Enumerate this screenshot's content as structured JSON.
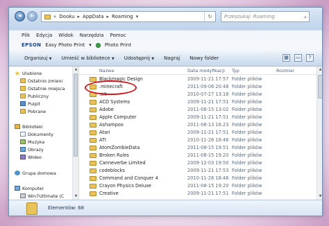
{
  "address": {
    "crumbs": [
      "Dooku",
      "AppData",
      "Roaming"
    ],
    "search_placeholder": "Przeszukaj: Roaming"
  },
  "menu": [
    "Plik",
    "Edycja",
    "Widok",
    "Narzędzia",
    "Pomoc"
  ],
  "epson": {
    "logo": "EPSON",
    "app1": "Easy Photo Print",
    "app2": "Photo Print"
  },
  "commands": {
    "organize": "Organizuj",
    "include": "Umieść w bibliotece",
    "share": "Udostępnij",
    "burn": "Nagraj",
    "new_folder": "Nowy folder"
  },
  "nav": {
    "favorites": "Ulubione",
    "recent": "Ostatnio zmieni",
    "recent_places": "Ostatnie miejsca",
    "public": "Publiczny",
    "desktop": "Pulpit",
    "downloads": "Pobrane",
    "libraries": "Biblioteki",
    "documents": "Dokumenty",
    "music": "Muzyka",
    "pictures": "Obrazy",
    "videos": "Wideo",
    "homegroup": "Grupa domowa",
    "computer": "Komputer",
    "drive": "Win7Ultimate (C"
  },
  "columns": {
    "name": "Nazwa",
    "date": "Data modyfikacji",
    "type": "Typ",
    "size": "Rozmiar"
  },
  "files": [
    {
      "name": "Blackmagic Design",
      "date": "2009-11-21 17:57",
      "type": "Folder plików"
    },
    {
      "name": ".minecraft",
      "date": "2011-09-06 20:48",
      "type": "Folder plików"
    },
    {
      "name": ".oit",
      "date": "2010-07-27 13:18",
      "type": "Folder plików"
    },
    {
      "name": "ACD Systems",
      "date": "2009-11-21 17:51",
      "type": "Folder plików"
    },
    {
      "name": "Adobe",
      "date": "2011-08-15 13:02",
      "type": "Folder plików"
    },
    {
      "name": "Apple Computer",
      "date": "2009-11-21 17:51",
      "type": "Folder plików"
    },
    {
      "name": "Ashampoo",
      "date": "2011-08-13 16:23",
      "type": "Folder plików"
    },
    {
      "name": "Atari",
      "date": "2009-11-21 17:51",
      "type": "Folder plików"
    },
    {
      "name": "ATI",
      "date": "2010-11-26 18:46",
      "type": "Folder plików"
    },
    {
      "name": "AtomZombieData",
      "date": "2011-08-15 19:51",
      "type": "Folder plików"
    },
    {
      "name": "Broken Rules",
      "date": "2011-08-15 19:20",
      "type": "Folder plików"
    },
    {
      "name": "Canneverbe Limited",
      "date": "2009-12-03 19:50",
      "type": "Folder plików"
    },
    {
      "name": "codeblocks",
      "date": "2009-11-21 17:53",
      "type": "Folder plików"
    },
    {
      "name": "Command and Conquer 4",
      "date": "2010-11-26 18:46",
      "type": "Folder plików"
    },
    {
      "name": "Crayon Physics Deluxe",
      "date": "2011-08-15 19:20",
      "type": "Folder plików"
    },
    {
      "name": "Creative",
      "date": "2009-11-21 17:51",
      "type": "Folder plików"
    }
  ],
  "status": {
    "count": "Elementów: 68"
  }
}
